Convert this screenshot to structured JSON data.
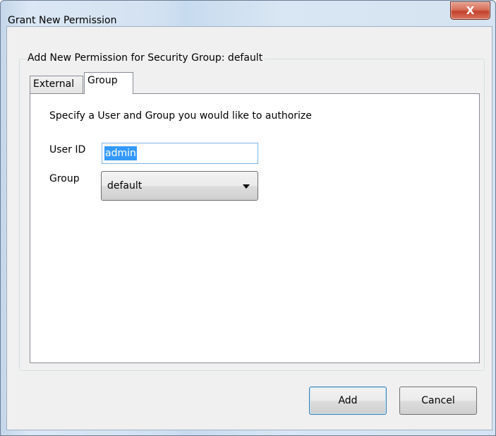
{
  "window": {
    "title": "Grant New Permission",
    "close_glyph": "X"
  },
  "form": {
    "groupbox_legend": "Add New Permission for Security Group: default",
    "tabs": [
      {
        "label": "External",
        "selected": false
      },
      {
        "label": "Group",
        "selected": true
      }
    ],
    "instructions": "Specify a User and Group you would like to authorize",
    "user_id_label": "User ID",
    "user_id_value": "admin",
    "group_label": "Group",
    "group_value": "default"
  },
  "buttons": {
    "add_label": "Add",
    "cancel_label": "Cancel"
  },
  "icons": {
    "close": "close-icon",
    "dropdown": "chevron-down-icon"
  },
  "colors": {
    "selection": "#3399ff",
    "close_button": "#c2412c",
    "focus_border": "#3c7fb1"
  }
}
